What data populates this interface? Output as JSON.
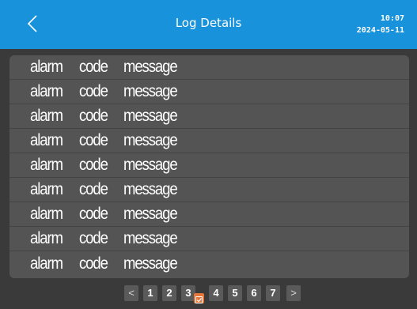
{
  "header": {
    "title": "Log Details",
    "time": "10:07",
    "date": "2024-05-11",
    "back_icon": "chevron-left-icon"
  },
  "log_rows": [
    {
      "alarm": "alarm",
      "code": "code",
      "message": "message"
    },
    {
      "alarm": "alarm",
      "code": "code",
      "message": "message"
    },
    {
      "alarm": "alarm",
      "code": "code",
      "message": "message"
    },
    {
      "alarm": "alarm",
      "code": "code",
      "message": "message"
    },
    {
      "alarm": "alarm",
      "code": "code",
      "message": "message"
    },
    {
      "alarm": "alarm",
      "code": "code",
      "message": "message"
    },
    {
      "alarm": "alarm",
      "code": "code",
      "message": "message"
    },
    {
      "alarm": "alarm",
      "code": "code",
      "message": "message"
    },
    {
      "alarm": "alarm",
      "code": "code",
      "message": "message"
    }
  ],
  "pagination": {
    "prev": "<",
    "next": ">",
    "pages": [
      "1",
      "2",
      "3",
      "4",
      "5",
      "6",
      "7"
    ],
    "current": "3"
  },
  "colors": {
    "header_bg": "#1892db",
    "page_bg": "#3a3a3a",
    "panel_bg": "#545454",
    "current_marker": "#e8763a"
  }
}
